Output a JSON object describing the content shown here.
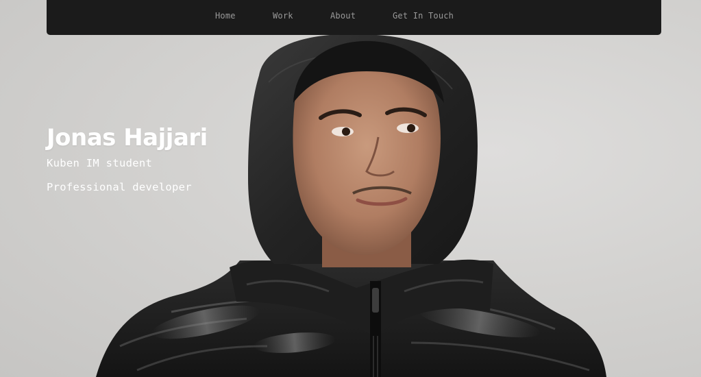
{
  "nav": {
    "items": [
      {
        "label": "Home"
      },
      {
        "label": "Work"
      },
      {
        "label": "About"
      },
      {
        "label": "Get In Touch"
      }
    ]
  },
  "hero": {
    "name": "Jonas Hajjari",
    "lines": [
      "Kuben IM student",
      "Professional developer"
    ],
    "photo_subject": "portrait of a young man in a dark hoodie and black puffer jacket"
  },
  "colors": {
    "navbar_bg": "#1b1b1b",
    "nav_text": "#9a9a9a",
    "page_bg": "#d3d2d0",
    "hero_text": "#ffffff"
  }
}
